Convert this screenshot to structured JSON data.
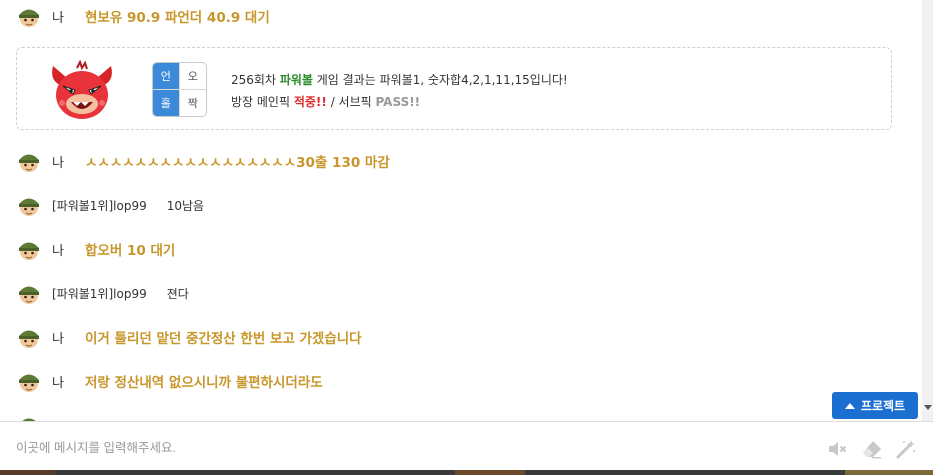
{
  "chat": {
    "me_label": "나",
    "messages": [
      {
        "kind": "me",
        "text": "현보유 90.9 파언더 40.9 대기"
      },
      {
        "kind": "me",
        "text": "ㅅㅅㅅㅅㅅㅅㅅㅅㅅㅅㅅㅅㅅㅅㅅㅅㅅ30출 130 마감"
      },
      {
        "kind": "other",
        "nick": "[파워볼1위]lop99",
        "text": "10남음"
      },
      {
        "kind": "me",
        "text": "합오버 10 대기"
      },
      {
        "kind": "other",
        "nick": "[파워볼1위]lop99",
        "text": "젼다"
      },
      {
        "kind": "me",
        "text": "이거 틀리던 맡던 중간정산 한번 보고 가겠습니다"
      },
      {
        "kind": "me",
        "text": "저랑 정산내역 없으시니까 불편하시더라도"
      }
    ]
  },
  "result_card": {
    "grid": {
      "top_left": "언",
      "top_right": "오",
      "bottom_left": "홀",
      "bottom_right": "짝"
    },
    "line1_prefix": "256회차 ",
    "line1_game": "파워볼",
    "line1_suffix": " 게임 결과는 파워볼1, 숫자합4,2,1,11,15입니다!",
    "line2_prefix": "방장 메인픽 ",
    "line2_hit": "적중!!",
    "line2_mid": " / 서브픽 ",
    "line2_pass": "PASS!!"
  },
  "project_button": {
    "label": "프로젝트"
  },
  "input": {
    "placeholder": "이곳에 메시지를 입력해주세요."
  },
  "icons": {
    "mute": "speaker-mute-icon",
    "eraser": "eraser-icon",
    "magic": "magic-wand-icon",
    "mascot": "red-devil-mascot",
    "avatar": "soldier-avatar-icon"
  },
  "colors": {
    "my_message": "#c8962a",
    "accent_blue": "#1a6fd1",
    "grid_active": "#3b8ad9",
    "game_name": "#2c8c2c",
    "hit": "#e02b2b"
  }
}
